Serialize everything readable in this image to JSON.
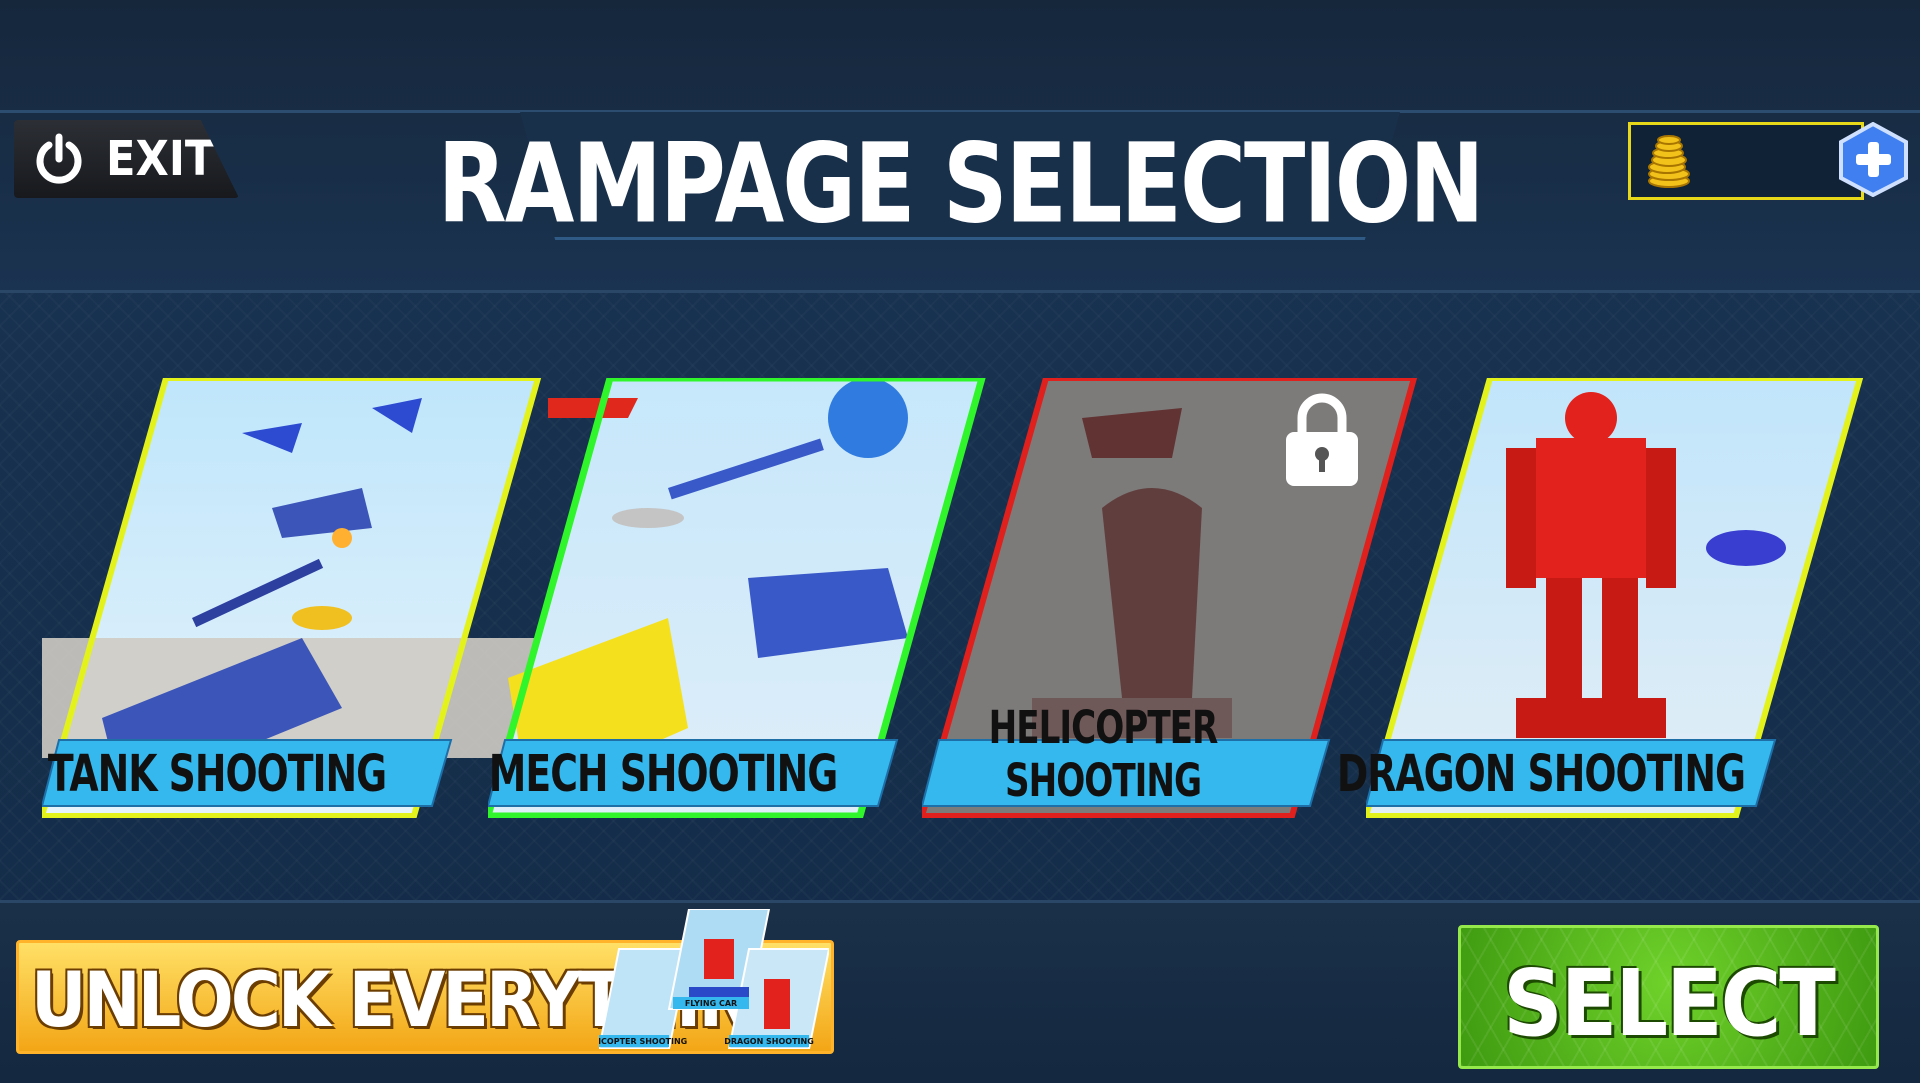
{
  "header": {
    "title": "RAMPAGE SELECTION",
    "exit_label": "EXIT",
    "coins_icon": "coin-stack-icon",
    "add_coins_icon": "plus-icon"
  },
  "modes": [
    {
      "label": "TANK SHOOTING",
      "state": "available",
      "border": "#e4f21c"
    },
    {
      "label": "MECH SHOOTING",
      "state": "selected",
      "border": "#2ff52a"
    },
    {
      "label": "HELICOPTER SHOOTING",
      "state": "locked",
      "border": "#e0201c"
    },
    {
      "label": "DRAGON SHOOTING",
      "state": "available",
      "border": "#e4f21c"
    }
  ],
  "unlock": {
    "label": "UNLOCK EVERYTHING",
    "thumbs": [
      "HELICOPTER SHOOTING",
      "FLYING CAR",
      "DRAGON SHOOTING"
    ]
  },
  "select_label": "SELECT",
  "colors": {
    "accent_label_bg": "#35b8ee",
    "select_green": "#5cc31d",
    "unlock_orange": "#f7b21e"
  }
}
